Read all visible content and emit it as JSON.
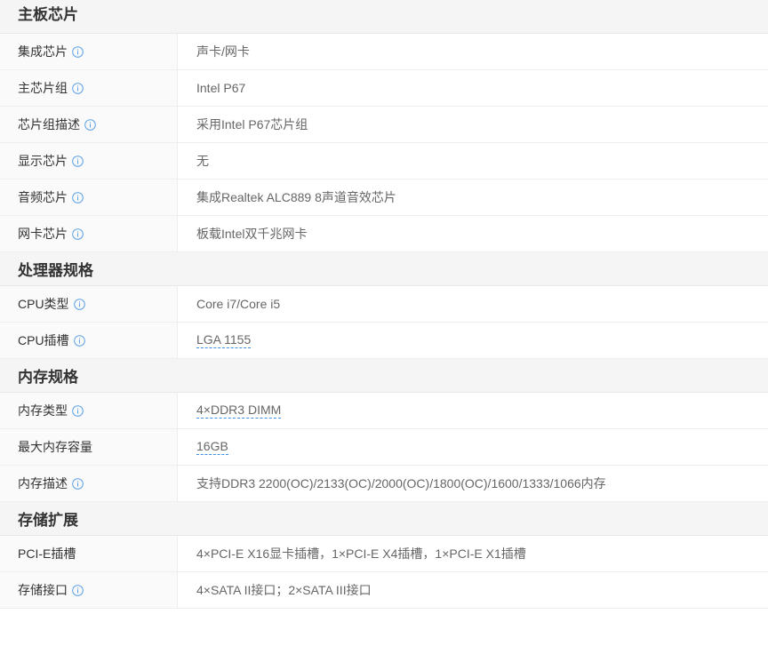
{
  "sections": [
    {
      "title": "主板芯片",
      "rows": [
        {
          "label": "集成芯片",
          "value": "声卡/网卡",
          "info": true,
          "linked": false
        },
        {
          "label": "主芯片组",
          "value": "Intel P67",
          "info": true,
          "linked": false
        },
        {
          "label": "芯片组描述",
          "value": "采用Intel P67芯片组",
          "info": true,
          "linked": false
        },
        {
          "label": "显示芯片",
          "value": "无",
          "info": true,
          "linked": false
        },
        {
          "label": "音频芯片",
          "value": "集成Realtek ALC889 8声道音效芯片",
          "info": true,
          "linked": false
        },
        {
          "label": "网卡芯片",
          "value": "板载Intel双千兆网卡",
          "info": true,
          "linked": false
        }
      ]
    },
    {
      "title": "处理器规格",
      "rows": [
        {
          "label": "CPU类型",
          "value": "Core i7/Core i5",
          "info": true,
          "linked": false
        },
        {
          "label": "CPU插槽",
          "value": "LGA 1155",
          "info": true,
          "linked": true
        }
      ]
    },
    {
      "title": "内存规格",
      "rows": [
        {
          "label": "内存类型",
          "value": "4×DDR3 DIMM",
          "info": true,
          "linked": true
        },
        {
          "label": "最大内存容量",
          "value": "16GB",
          "info": false,
          "linked": true
        },
        {
          "label": "内存描述",
          "value": "支持DDR3 2200(OC)/2133(OC)/2000(OC)/1800(OC)/1600/1333/1066内存",
          "info": true,
          "linked": false
        }
      ]
    },
    {
      "title": "存储扩展",
      "rows": [
        {
          "label": "PCI-E插槽",
          "value": "4×PCI-E X16显卡插槽，1×PCI-E X4插槽，1×PCI-E X1插槽",
          "info": false,
          "linked": false
        },
        {
          "label": "存储接口",
          "value": "4×SATA II接口；2×SATA III接口",
          "info": true,
          "linked": false
        }
      ]
    }
  ],
  "icons": {
    "info": "info-circle-icon"
  },
  "colors": {
    "info_icon": "#5aa0e6",
    "link_underline": "#3a8ee6",
    "header_bg": "#f5f5f5"
  }
}
